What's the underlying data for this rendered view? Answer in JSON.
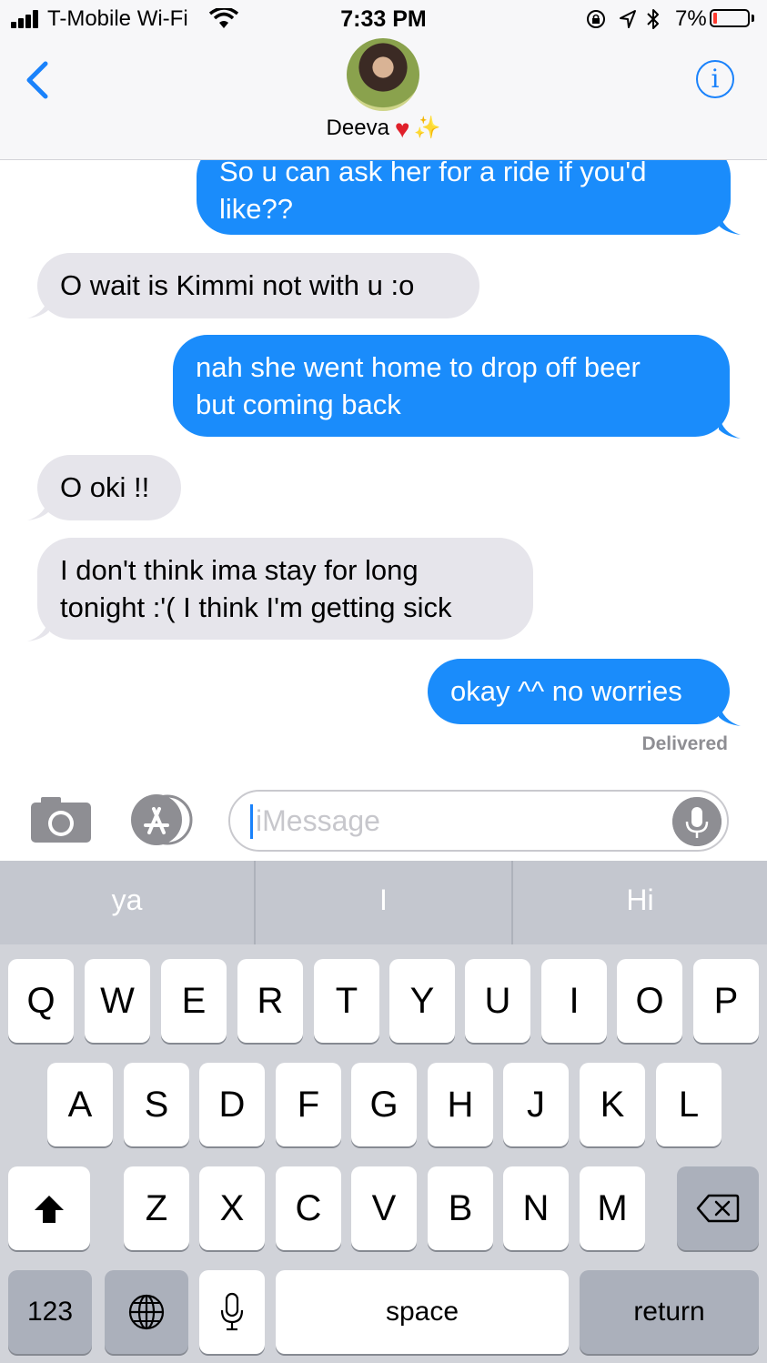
{
  "status_bar": {
    "carrier": "T-Mobile Wi-Fi",
    "time": "7:33 PM",
    "battery_percent": "7%"
  },
  "header": {
    "contact_name": "Deeva",
    "heart": "♥",
    "sparkle": "✨",
    "back_icon": "chevron-left-icon",
    "info_icon": "info-icon",
    "info_label": "i"
  },
  "messages": [
    {
      "from": "me",
      "text": "So u can ask her for a ride if you'd\nlike??"
    },
    {
      "from": "them",
      "text": "O wait is Kimmi not with u :o"
    },
    {
      "from": "me",
      "text": "nah she went home to drop off beer\nbut coming back"
    },
    {
      "from": "them",
      "text": "O oki !!"
    },
    {
      "from": "them",
      "text": "I don't think ima stay for long\ntonight :'( I think I'm getting sick"
    },
    {
      "from": "me",
      "text": "okay ^^ no worries"
    }
  ],
  "delivered_label": "Delivered",
  "input": {
    "placeholder": "iMessage"
  },
  "keyboard": {
    "predictions": [
      "ya",
      "I",
      "Hi"
    ],
    "row1": [
      "Q",
      "W",
      "E",
      "R",
      "T",
      "Y",
      "U",
      "I",
      "O",
      "P"
    ],
    "row2": [
      "A",
      "S",
      "D",
      "F",
      "G",
      "H",
      "J",
      "K",
      "L"
    ],
    "row3": [
      "Z",
      "X",
      "C",
      "V",
      "B",
      "N",
      "M"
    ],
    "numbers_label": "123",
    "space_label": "space",
    "return_label": "return"
  },
  "colors": {
    "sent_bubble": "#1a8cfb",
    "received_bubble": "#e6e5eb",
    "accent": "#1a82fb",
    "keyboard_bg": "#d1d3d9"
  }
}
